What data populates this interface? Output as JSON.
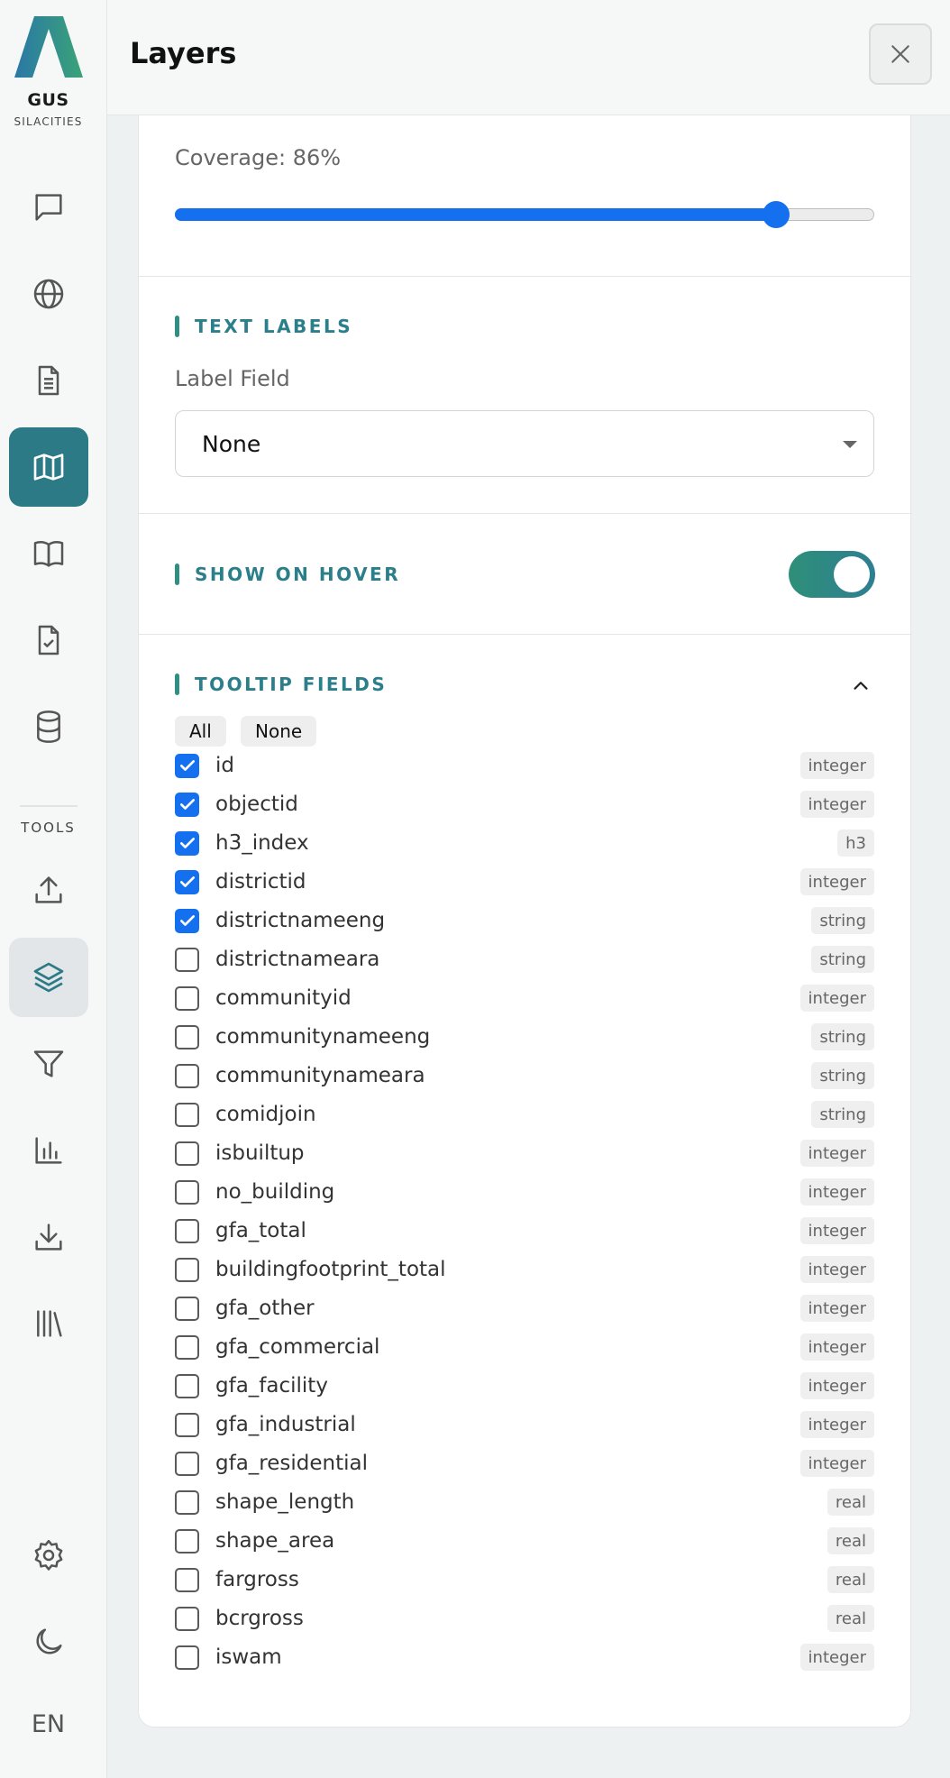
{
  "app": {
    "logo_name": "GUS",
    "logo_sub": "SILACITIES"
  },
  "sidebar": {
    "tools_label": "TOOLS",
    "language": "EN",
    "accent_color": "#2b7a86",
    "items": [
      {
        "name": "chat",
        "icon": "chat-icon",
        "state": "normal"
      },
      {
        "name": "globe",
        "icon": "globe-icon",
        "state": "normal"
      },
      {
        "name": "document",
        "icon": "document-icon",
        "state": "normal"
      },
      {
        "name": "map",
        "icon": "map-icon",
        "state": "active"
      },
      {
        "name": "book",
        "icon": "book-open-icon",
        "state": "normal"
      },
      {
        "name": "checklist",
        "icon": "file-check-icon",
        "state": "normal"
      },
      {
        "name": "database",
        "icon": "database-icon",
        "state": "normal"
      },
      {
        "name": "upload",
        "icon": "upload-icon",
        "state": "normal"
      },
      {
        "name": "layers",
        "icon": "layers-icon",
        "state": "selected"
      },
      {
        "name": "filter",
        "icon": "filter-icon",
        "state": "normal"
      },
      {
        "name": "chart",
        "icon": "bar-chart-icon",
        "state": "normal"
      },
      {
        "name": "download",
        "icon": "download-icon",
        "state": "normal"
      },
      {
        "name": "library",
        "icon": "library-icon",
        "state": "normal"
      },
      {
        "name": "settings",
        "icon": "gear-icon",
        "state": "normal"
      },
      {
        "name": "theme",
        "icon": "moon-icon",
        "state": "normal"
      }
    ]
  },
  "header": {
    "title": "Layers"
  },
  "coverage": {
    "label": "Coverage: 86%",
    "value": 0.86
  },
  "text_labels": {
    "heading": "TEXT LABELS",
    "field_label": "Label Field",
    "selected": "None"
  },
  "show_on_hover": {
    "heading": "SHOW ON HOVER",
    "enabled": true
  },
  "tooltip_fields": {
    "heading": "TOOLTIP FIELDS",
    "all_label": "All",
    "none_label": "None",
    "fields": [
      {
        "name": "id",
        "type": "integer",
        "checked": true
      },
      {
        "name": "objectid",
        "type": "integer",
        "checked": true
      },
      {
        "name": "h3_index",
        "type": "h3",
        "checked": true
      },
      {
        "name": "districtid",
        "type": "integer",
        "checked": true
      },
      {
        "name": "districtnameeng",
        "type": "string",
        "checked": true
      },
      {
        "name": "districtnameara",
        "type": "string",
        "checked": false
      },
      {
        "name": "communityid",
        "type": "integer",
        "checked": false
      },
      {
        "name": "communitynameeng",
        "type": "string",
        "checked": false
      },
      {
        "name": "communitynameara",
        "type": "string",
        "checked": false
      },
      {
        "name": "comidjoin",
        "type": "string",
        "checked": false
      },
      {
        "name": "isbuiltup",
        "type": "integer",
        "checked": false
      },
      {
        "name": "no_building",
        "type": "integer",
        "checked": false
      },
      {
        "name": "gfa_total",
        "type": "integer",
        "checked": false
      },
      {
        "name": "buildingfootprint_total",
        "type": "integer",
        "checked": false
      },
      {
        "name": "gfa_other",
        "type": "integer",
        "checked": false
      },
      {
        "name": "gfa_commercial",
        "type": "integer",
        "checked": false
      },
      {
        "name": "gfa_facility",
        "type": "integer",
        "checked": false
      },
      {
        "name": "gfa_industrial",
        "type": "integer",
        "checked": false
      },
      {
        "name": "gfa_residential",
        "type": "integer",
        "checked": false
      },
      {
        "name": "shape_length",
        "type": "real",
        "checked": false
      },
      {
        "name": "shape_area",
        "type": "real",
        "checked": false
      },
      {
        "name": "fargross",
        "type": "real",
        "checked": false
      },
      {
        "name": "bcrgross",
        "type": "real",
        "checked": false
      },
      {
        "name": "iswam",
        "type": "integer",
        "checked": false
      }
    ]
  }
}
